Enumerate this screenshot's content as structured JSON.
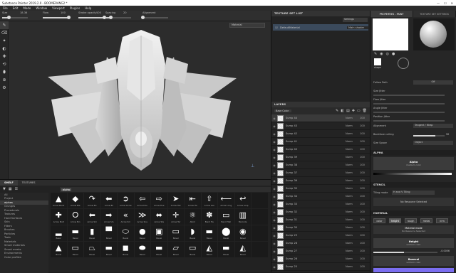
{
  "window": {
    "title": "Substance Painter 2019.2.0 - BOOMERANG2 *",
    "controls": [
      "—",
      "☐",
      "✕"
    ]
  },
  "menu": [
    "File",
    "Edit",
    "Mode",
    "Window",
    "Viewport",
    "Plugins",
    "Help"
  ],
  "tool_options": [
    {
      "label": "Size",
      "value": "18.36",
      "fill": 0.25
    },
    {
      "label": "Flow",
      "value": "100",
      "fill": 1.0
    },
    {
      "label": "Stroke opacity",
      "value": "100",
      "fill": 1.0
    },
    {
      "label": "Spacing",
      "value": "20",
      "fill": 0.2
    },
    {
      "label": "Alignment",
      "value": "",
      "fill": 0
    }
  ],
  "left_tools": [
    "✎",
    "⌫",
    "✦",
    "◐",
    "✚",
    "⟲",
    "⬮",
    "⊕",
    "⚙"
  ],
  "viewport": {
    "material_select": "Material"
  },
  "texture_set_list": {
    "title": "TEXTURE SET LIST",
    "dropdown": "Settings",
    "item": "DefaultMaterial",
    "item_mode": "Main shader"
  },
  "layers": {
    "title": "LAYERS",
    "blend_mode": "Base Color",
    "items": [
      {
        "name": "Sump 44",
        "blend": "Norm",
        "opacity": "100"
      },
      {
        "name": "Sump 43",
        "blend": "Norm",
        "opacity": "100"
      },
      {
        "name": "Sump 42",
        "blend": "Norm",
        "opacity": "100"
      },
      {
        "name": "Sump 41",
        "blend": "Norm",
        "opacity": "100"
      },
      {
        "name": "Sump 40",
        "blend": "Norm",
        "opacity": "100"
      },
      {
        "name": "Sump 39",
        "blend": "Norm",
        "opacity": "100"
      },
      {
        "name": "Sump 38",
        "blend": "Norm",
        "opacity": "100"
      },
      {
        "name": "Sump 37",
        "blend": "Norm",
        "opacity": "100"
      },
      {
        "name": "Sump 36",
        "blend": "Norm",
        "opacity": "100"
      },
      {
        "name": "Sump 35",
        "blend": "Norm",
        "opacity": "100"
      },
      {
        "name": "Sump 34",
        "blend": "Norm",
        "opacity": "100"
      },
      {
        "name": "Sump 33",
        "blend": "Norm",
        "opacity": "100"
      },
      {
        "name": "Sump 32",
        "blend": "Norm",
        "opacity": "100"
      },
      {
        "name": "Sump 31",
        "blend": "Norm",
        "opacity": "100"
      },
      {
        "name": "Sump 30",
        "blend": "Norm",
        "opacity": "100"
      },
      {
        "name": "Sump 29",
        "blend": "Norm",
        "opacity": "100"
      },
      {
        "name": "Sump 28",
        "blend": "Norm",
        "opacity": "100"
      },
      {
        "name": "Sump 27",
        "blend": "Norm",
        "opacity": "100"
      },
      {
        "name": "Sump 26",
        "blend": "Norm",
        "opacity": "100"
      },
      {
        "name": "Sump 25",
        "blend": "Norm",
        "opacity": "100"
      }
    ]
  },
  "properties": {
    "tab_paint": "PROPERTIES - PAINT",
    "tab_texset": "TEXTURE SET SETTINGS",
    "brush_label": "shape",
    "rows": [
      {
        "label": "Follow Path",
        "value": "Off"
      },
      {
        "label": "Size Jitter",
        "value": "",
        "fill": 0.0
      },
      {
        "label": "Flow Jitter",
        "value": "",
        "fill": 0.0
      },
      {
        "label": "Angle Jitter",
        "value": "",
        "fill": 0.0
      },
      {
        "label": "Position Jitter",
        "value": "",
        "fill": 0.0
      }
    ],
    "alignment": {
      "label": "Alignment",
      "value": "Tangent / Wrap"
    },
    "backface": {
      "label": "Backface culling",
      "value": "90"
    },
    "size_space": {
      "label": "Size Space",
      "value": "Object"
    },
    "alpha_section": "ALPHA",
    "alpha_name": "Alpha",
    "alpha_sub": "medium color",
    "stencil_section": "STENCIL",
    "tiling_label": "Tiling mode",
    "tiling_value": "H and V Tiling",
    "stencil_btn": "No Resource Selected",
    "material_section": "MATERIAL",
    "mat_buttons": [
      "color",
      "height",
      "rough",
      "metal",
      "nrm"
    ],
    "mat_mode_title": "Material mode",
    "mat_mode_value": "No Resource Selected",
    "height_title": "Height",
    "height_sub": "uniform color",
    "height_value": "-0.0056",
    "basecolor_title": "Basecol",
    "basecolor_sub": "uniform color",
    "basecolor_hex": "#7b6ef0"
  },
  "shelf": {
    "tabs": [
      "SHELF",
      "TEXTURES"
    ],
    "search": "alpha",
    "categories": [
      "All",
      "Project",
      "alphas",
      "Grunges",
      "Procedurals",
      "Textures",
      "Hard Surfaces",
      "Skin",
      "Filters",
      "Brushes",
      "Particles",
      "Tools",
      "Materials",
      "Smart materials",
      "Smart masks",
      "Environments",
      "Color profiles"
    ],
    "active_category": "alphas",
    "tiles": [
      {
        "icon": "▲",
        "label": "Arrow Bend"
      },
      {
        "icon": "◆",
        "label": "Arrow Bla"
      },
      {
        "icon": "↷",
        "label": "Arrow Bo"
      },
      {
        "icon": "⬅",
        "label": "Arrow Bi"
      },
      {
        "icon": "➲",
        "label": "Arrow Circle"
      },
      {
        "icon": "⇦",
        "label": "Arrow Dou"
      },
      {
        "icon": "⇨",
        "label": "Arrow Five"
      },
      {
        "icon": "➤",
        "label": "Arrow Har"
      },
      {
        "icon": "⇤",
        "label": "Arrow Ha"
      },
      {
        "icon": "⇧",
        "label": "Arrow Lea"
      },
      {
        "icon": "⟵",
        "label": "Arrow Long"
      },
      {
        "icon": "↩",
        "label": "Arrow Loop"
      },
      {
        "icon": " ",
        "label": ""
      },
      {
        "icon": "✚",
        "label": "Arrow Mult"
      },
      {
        "icon": "⭘",
        "label": "Arrow Nin"
      },
      {
        "icon": "⬅",
        "label": "Arrow Sm"
      },
      {
        "icon": "➡",
        "label": "Arrow Sm"
      },
      {
        "icon": "«",
        "label": "Arrow Sm"
      },
      {
        "icon": "≫",
        "label": "Arrow Sna"
      },
      {
        "icon": "⬌",
        "label": "Arrow Ste"
      },
      {
        "icon": "✛",
        "label": "Arrow Tar"
      },
      {
        "icon": "⚛",
        "label": "Atom"
      },
      {
        "icon": "✽",
        "label": "Band Ha"
      },
      {
        "icon": "▭",
        "label": "Band Hall"
      },
      {
        "icon": "▥",
        "label": "Barcode"
      },
      {
        "icon": " ",
        "label": ""
      },
      {
        "icon": "▂",
        "label": "Basic"
      },
      {
        "icon": "▬",
        "label": "Bevel"
      },
      {
        "icon": "▮",
        "label": "Bevel"
      },
      {
        "icon": "▀",
        "label": "Bevel"
      },
      {
        "icon": "⬭",
        "label": "Bevel"
      },
      {
        "icon": "●",
        "label": "Bevel"
      },
      {
        "icon": "▣",
        "label": "Bevel"
      },
      {
        "icon": "▭",
        "label": "Bevel"
      },
      {
        "icon": "◗",
        "label": "Bevel"
      },
      {
        "icon": "▬",
        "label": "Bevel"
      },
      {
        "icon": "⬤",
        "label": "Bevel"
      },
      {
        "icon": "◉",
        "label": "Bevel"
      },
      {
        "icon": " ",
        "label": ""
      },
      {
        "icon": "▲",
        "label": "Bevel"
      },
      {
        "icon": "▭",
        "label": "Bevel"
      },
      {
        "icon": "⏢",
        "label": "Bevel"
      },
      {
        "icon": "▬",
        "label": "Bevel"
      },
      {
        "icon": "◼",
        "label": "Bevel"
      },
      {
        "icon": "⬬",
        "label": "Bevel"
      },
      {
        "icon": "▬",
        "label": "Bevel"
      },
      {
        "icon": "▱",
        "label": "Bevel"
      },
      {
        "icon": "▭",
        "label": "Bevel"
      },
      {
        "icon": "◭",
        "label": "Bevel"
      },
      {
        "icon": "▬",
        "label": "Bevel"
      },
      {
        "icon": "◭",
        "label": "Bevel"
      },
      {
        "icon": " ",
        "label": ""
      }
    ]
  }
}
